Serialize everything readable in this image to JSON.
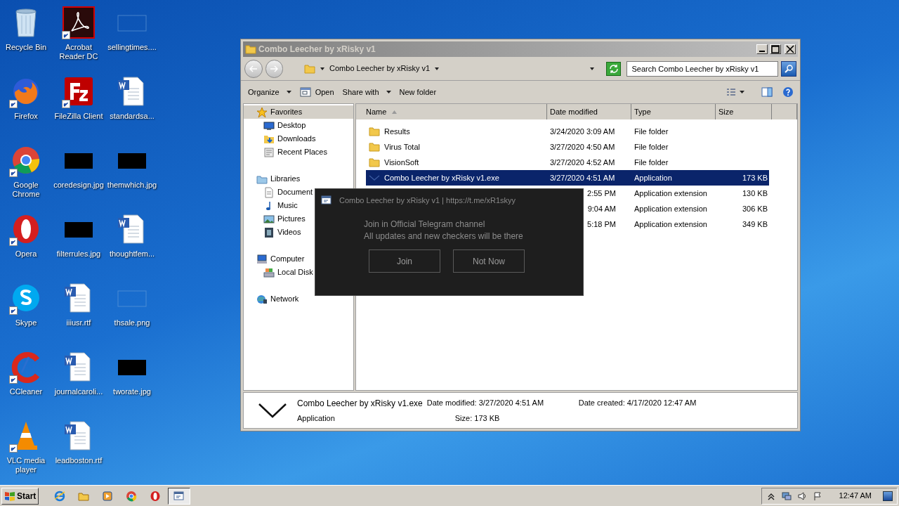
{
  "desktop_icons": [
    {
      "label": "Recycle Bin",
      "kind": "recycle",
      "shortcut": false
    },
    {
      "label": "Firefox",
      "kind": "firefox",
      "shortcut": true
    },
    {
      "label": "Google Chrome",
      "kind": "chrome",
      "shortcut": true
    },
    {
      "label": "Opera",
      "kind": "opera",
      "shortcut": true
    },
    {
      "label": "Skype",
      "kind": "skype",
      "shortcut": true
    },
    {
      "label": "CCleaner",
      "kind": "ccleaner",
      "shortcut": true
    },
    {
      "label": "VLC media player",
      "kind": "vlc",
      "shortcut": true
    },
    {
      "label": "Acrobat Reader DC",
      "kind": "acrobat",
      "shortcut": true
    },
    {
      "label": "FileZilla Client",
      "kind": "filezilla",
      "shortcut": true
    },
    {
      "label": "coredesign.jpg",
      "kind": "dark-thumb",
      "shortcut": false
    },
    {
      "label": "filterrules.jpg",
      "kind": "dark-thumb",
      "shortcut": false
    },
    {
      "label": "iiiusr.rtf",
      "kind": "word",
      "shortcut": false
    },
    {
      "label": "journalcaroli...",
      "kind": "word",
      "shortcut": false
    },
    {
      "label": "leadboston.rtf",
      "kind": "word",
      "shortcut": false
    },
    {
      "label": "sellingtimes....",
      "kind": "blank-thumb",
      "shortcut": false
    },
    {
      "label": "standardsa...",
      "kind": "word",
      "shortcut": false
    },
    {
      "label": "themwhich.jpg",
      "kind": "dark-thumb",
      "shortcut": false
    },
    {
      "label": "thoughtfem...",
      "kind": "word",
      "shortcut": false
    },
    {
      "label": "thsale.png",
      "kind": "blank-thumb",
      "shortcut": false
    },
    {
      "label": "tworate.jpg",
      "kind": "dark-thumb",
      "shortcut": false
    }
  ],
  "window": {
    "title": "Combo Leecher by xRisky v1",
    "address": "Combo Leecher by xRisky v1",
    "search": {
      "placeholder": "Search Combo Leecher by xRisky v1"
    },
    "toolbar": [
      {
        "label": "Organize",
        "kind": "menu"
      },
      {
        "label": "Open",
        "kind": "open"
      },
      {
        "label": "Share with",
        "kind": "menu"
      },
      {
        "label": "New folder",
        "kind": "plain"
      }
    ],
    "sidebar": [
      {
        "label": "Favorites",
        "kind": "star",
        "selected": true,
        "children": [
          {
            "label": "Desktop",
            "kind": "desktop"
          },
          {
            "label": "Downloads",
            "kind": "downloads"
          },
          {
            "label": "Recent Places",
            "kind": "recent"
          }
        ]
      },
      {
        "label": "Libraries",
        "kind": "library",
        "selected": false,
        "children": [
          {
            "label": "Document",
            "kind": "doc"
          },
          {
            "label": "Music",
            "kind": "music"
          },
          {
            "label": "Pictures",
            "kind": "pictures"
          },
          {
            "label": "Videos",
            "kind": "videos"
          }
        ]
      },
      {
        "label": "Computer",
        "kind": "computer",
        "selected": false,
        "children": [
          {
            "label": "Local Disk",
            "kind": "disk"
          }
        ]
      },
      {
        "label": "Network",
        "kind": "network",
        "selected": false
      }
    ],
    "columns": [
      "Name",
      "Date modified",
      "Type",
      "Size"
    ],
    "rows": [
      {
        "name": "Results",
        "date": "3/24/2020 3:09 AM",
        "type": "File folder",
        "size": "",
        "kind": "folder",
        "selected": false
      },
      {
        "name": "Virus Total",
        "date": "3/27/2020 4:50 AM",
        "type": "File folder",
        "size": "",
        "kind": "folder",
        "selected": false
      },
      {
        "name": "VisionSoft",
        "date": "3/27/2020 4:52 AM",
        "type": "File folder",
        "size": "",
        "kind": "folder",
        "selected": false
      },
      {
        "name": "Combo Leecher by xRisky v1.exe",
        "date": "3/27/2020 4:51 AM",
        "type": "Application",
        "size": "173 KB",
        "kind": "exe",
        "selected": true
      },
      {
        "name": "",
        "date": "2:55 PM",
        "type": "Application extension",
        "size": "130 KB",
        "kind": "hidden",
        "selected": false
      },
      {
        "name": "",
        "date": "9:04 AM",
        "type": "Application extension",
        "size": "306 KB",
        "kind": "hidden",
        "selected": false
      },
      {
        "name": "",
        "date": "5:18 PM",
        "type": "Application extension",
        "size": "349 KB",
        "kind": "hidden",
        "selected": false
      }
    ],
    "details": {
      "name": "Combo Leecher by xRisky v1.exe",
      "type": "Application",
      "modified": "Date modified: 3/27/2020 4:51 AM",
      "size": "Size: 173 KB",
      "created": "Date created: 4/17/2020 12:47 AM"
    }
  },
  "dialog": {
    "title": "Combo Leecher by xRisky v1 | https://t.me/xR1skyy",
    "message": [
      "Join in Official Telegram channel",
      "All updates and new checkers will be there"
    ],
    "buttons": [
      "Join",
      "Not Now"
    ]
  },
  "taskbar": {
    "start": "Start",
    "apps": [
      {
        "kind": "ie",
        "selected": false
      },
      {
        "kind": "explorer",
        "selected": false
      },
      {
        "kind": "media",
        "selected": false
      },
      {
        "kind": "chrome",
        "selected": false
      },
      {
        "kind": "opera",
        "selected": false
      },
      {
        "kind": "dialog",
        "selected": true
      }
    ],
    "tray": [
      {
        "kind": "up"
      },
      {
        "kind": "network"
      },
      {
        "kind": "volume"
      },
      {
        "kind": "flag"
      }
    ],
    "clock": "12:47 AM"
  }
}
